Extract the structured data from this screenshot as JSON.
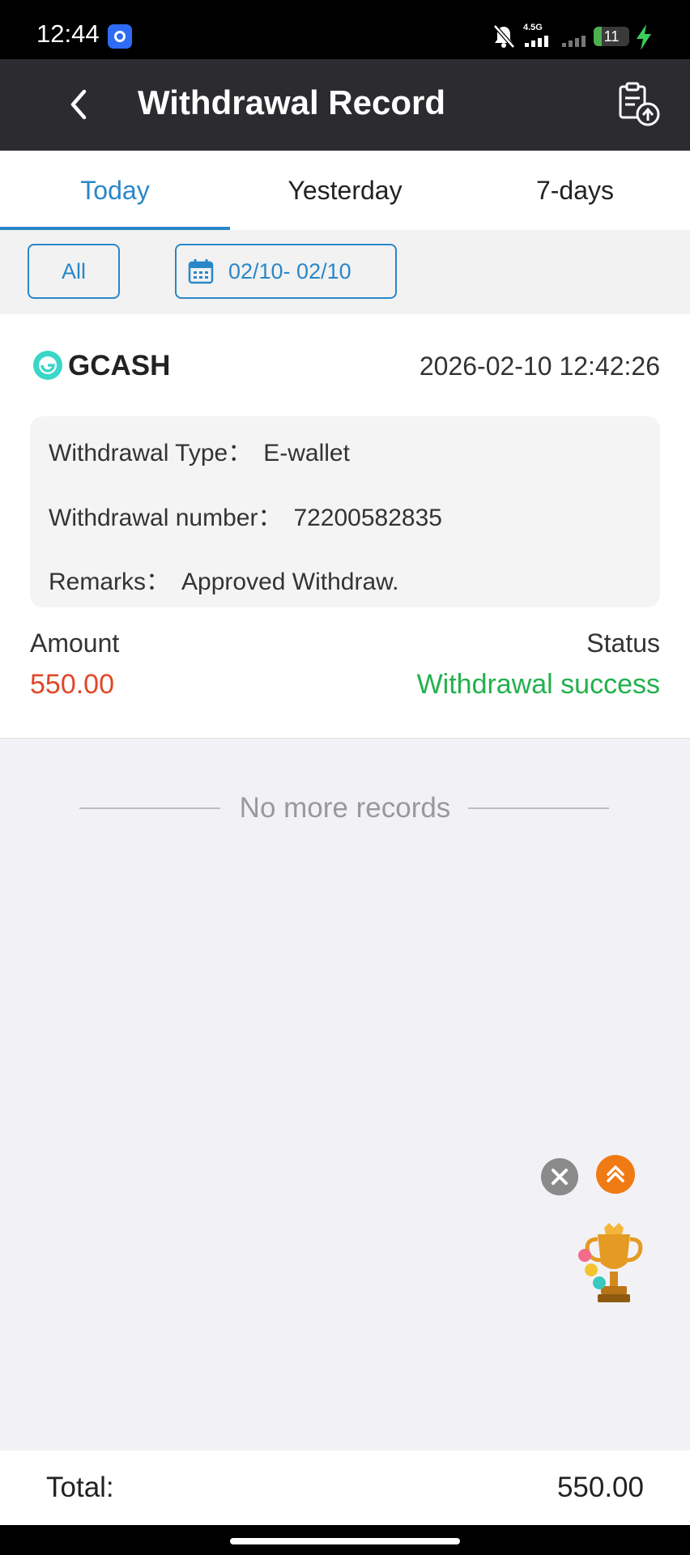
{
  "status_bar": {
    "time": "12:44",
    "network": "4.5G",
    "battery": "11",
    "battery_level": 0.11,
    "icons": [
      "app-icon",
      "bell-off-icon",
      "signal-icon",
      "battery-icon",
      "charging-icon"
    ]
  },
  "header": {
    "title": "Withdrawal Record",
    "back_icon": "chevron-left-icon",
    "export_icon": "clipboard-upload-icon"
  },
  "tabs": [
    {
      "label": "Today",
      "active": true
    },
    {
      "label": "Yesterday",
      "active": false
    },
    {
      "label": "7-days",
      "active": false
    }
  ],
  "filters": {
    "all_label": "All",
    "date_range": "02/10- 02/10",
    "date_icon": "calendar-icon"
  },
  "record": {
    "provider": "GCASH",
    "datetime": "2026-02-10 12:42:26",
    "type_label": "Withdrawal Type：",
    "type_value": "E-wallet",
    "number_label": "Withdrawal number：",
    "number_value": "72200582835",
    "remarks_label": "Remarks：",
    "remarks_value": "Approved Withdraw.",
    "amount_label": "Amount",
    "amount_value": "550.00",
    "status_label": "Status",
    "status_value": "Withdrawal success"
  },
  "list_end_text": "No more records",
  "total": {
    "label": "Total:",
    "value": "550.00"
  },
  "colors": {
    "accent": "#2a87c8",
    "header_bg": "#2c2c30",
    "amount": "#e0482a",
    "success": "#22b14c",
    "fab_top": "#f07a14"
  }
}
